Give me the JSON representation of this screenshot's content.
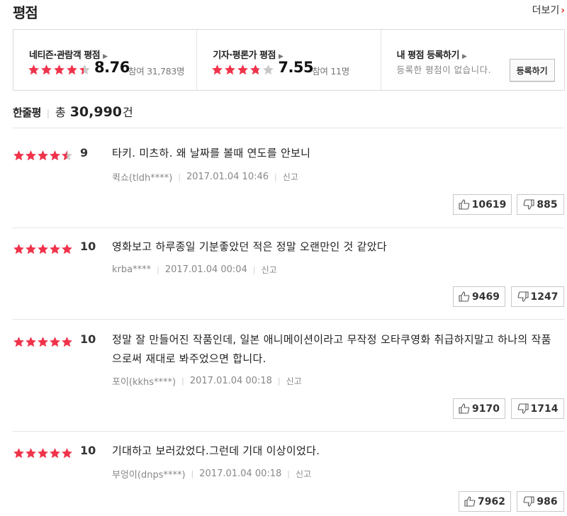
{
  "header": {
    "title": "평점",
    "more_label": "더보기",
    "more_icon": "chevron-right"
  },
  "ratings": {
    "netizen": {
      "label": "네티즌·관람객 평점",
      "stars": 4.4,
      "score": "8.76",
      "participants": "참여 31,783명"
    },
    "critic": {
      "label": "기자·평론가 평점",
      "stars": 3.8,
      "score": "7.55",
      "participants": "참여 11명"
    },
    "mine": {
      "label": "내 평점 등록하기",
      "empty_text": "등록한 평점이 없습니다.",
      "register_label": "등록하기"
    }
  },
  "oneline": {
    "label": "한줄평",
    "total_prefix": "총",
    "total_count": "30,990",
    "total_suffix": "건"
  },
  "reviews": [
    {
      "stars": 4.5,
      "score": "9",
      "text": "타키. 미츠하. 왜 날짜를 볼때 연도를 안보니",
      "author": "퀵쇼(tldh****)",
      "datetime": "2017.01.04 10:46",
      "report": "신고",
      "likes": "10619",
      "dislikes": "885"
    },
    {
      "stars": 5,
      "score": "10",
      "text": "영화보고 하루종일 기분좋았던 적은 정말 오랜만인 것 같았다",
      "author": "krba****",
      "datetime": "2017.01.04 00:04",
      "report": "신고",
      "likes": "9469",
      "dislikes": "1247"
    },
    {
      "stars": 5,
      "score": "10",
      "text": "정말 잘 만들어진 작품인데, 일본 애니메이션이라고 무작정 오타쿠영화 취급하지말고 하나의 작품으로써 재대로 봐주었으면 합니다.",
      "author": "포이(kkhs****)",
      "datetime": "2017.01.04 00:18",
      "report": "신고",
      "likes": "9170",
      "dislikes": "1714"
    },
    {
      "stars": 5,
      "score": "10",
      "text": "기대하고 보러갔었다.그런데 기대 이상이었다.",
      "author": "부엉이(dnps****)",
      "datetime": "2017.01.04 00:18",
      "report": "신고",
      "likes": "7962",
      "dislikes": "986"
    }
  ],
  "colors": {
    "star_on": "#f0334a",
    "star_off": "#c8c8c8",
    "accent": "#e03333"
  }
}
